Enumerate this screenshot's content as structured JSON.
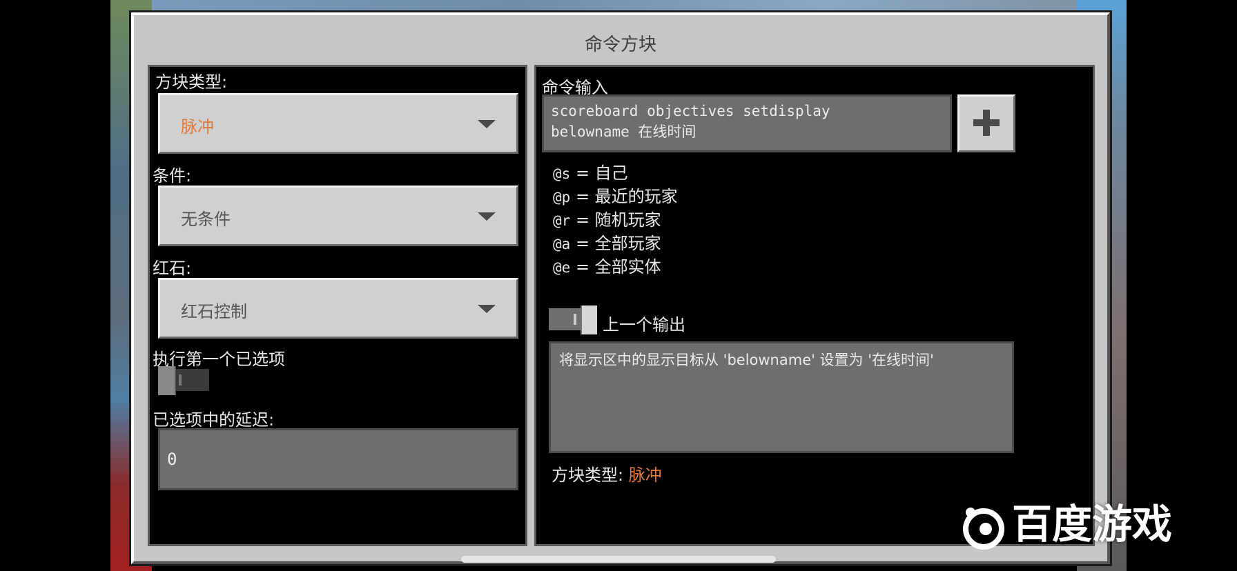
{
  "window": {
    "title": "命令方块"
  },
  "left_panel": {
    "block_type": {
      "label": "方块类型:",
      "value": "脉冲"
    },
    "condition": {
      "label": "条件:",
      "value": "无条件"
    },
    "redstone": {
      "label": "红石:",
      "value": "红石控制"
    },
    "execute_first": {
      "label": "执行第一个已选项",
      "state": "off"
    },
    "delay": {
      "label": "已选项中的延迟:",
      "value": "0"
    }
  },
  "right_panel": {
    "command_label": "命令输入",
    "command_line1": "scoreboard objectives setdisplay",
    "command_line2": "belowname 在线时间",
    "selectors": [
      {
        "code": "@s",
        "desc": "= 自己"
      },
      {
        "code": "@p",
        "desc": "= 最近的玩家"
      },
      {
        "code": "@r",
        "desc": "= 随机玩家"
      },
      {
        "code": "@a",
        "desc": "= 全部玩家"
      },
      {
        "code": "@e",
        "desc": "= 全部实体"
      }
    ],
    "previous_output": {
      "label": "上一个输出",
      "state": "on"
    },
    "output_text": "将显示区中的显示目标从 'belowname' 设置为 '在线时间'",
    "block_type_footer": {
      "label": "方块类型:",
      "value": "脉冲"
    }
  },
  "watermark": {
    "text": "百度游戏",
    "icon": "baidu-games-logo-icon"
  },
  "colors": {
    "accent_orange": "#e07a3c",
    "panel_bg": "#000000",
    "window_bg": "#c6c6c6"
  }
}
